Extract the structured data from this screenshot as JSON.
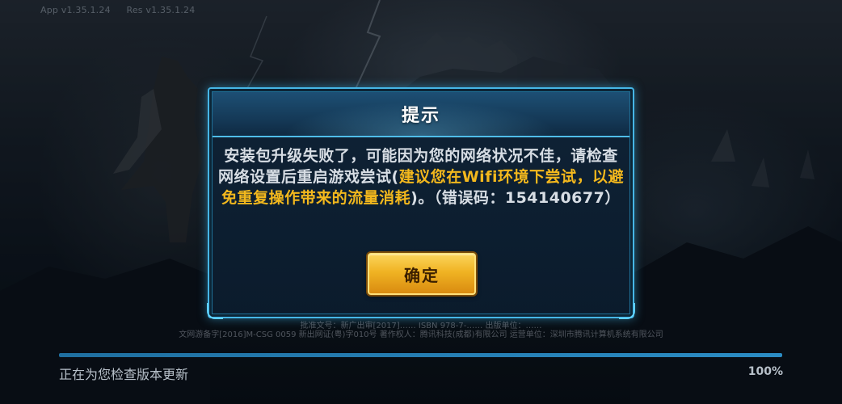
{
  "header": {
    "app_version": "App v1.35.1.24",
    "res_version": "Res v1.35.1.24"
  },
  "dialog": {
    "title": "提示",
    "message_part1": "安装包升级失败了，可能因为您的网络状况不佳，请检查网络设置后重启游戏尝试(",
    "message_highlight": "建议您在Wifi环境下尝试，以避免重复操作带来的流量消耗",
    "message_part2": ")。（错误码：154140677）",
    "confirm_label": "确定"
  },
  "legal": {
    "line1": "批准文号：新广出审[2017]…… ISBN 978-7-…… 出版单位：……",
    "line2": "文网游备字[2016]M-CSG 0059  新出网证(粤)字010号  著作权人：腾讯科技(成都)有限公司  运营单位：深圳市腾讯计算机系统有限公司"
  },
  "progress": {
    "status": "正在为您检查版本更新",
    "percent_label": "100%",
    "value": 1.0
  },
  "colors": {
    "accent_blue": "#46b6e6",
    "highlight_gold": "#f3b81d",
    "button_gold": "#f0b323"
  }
}
